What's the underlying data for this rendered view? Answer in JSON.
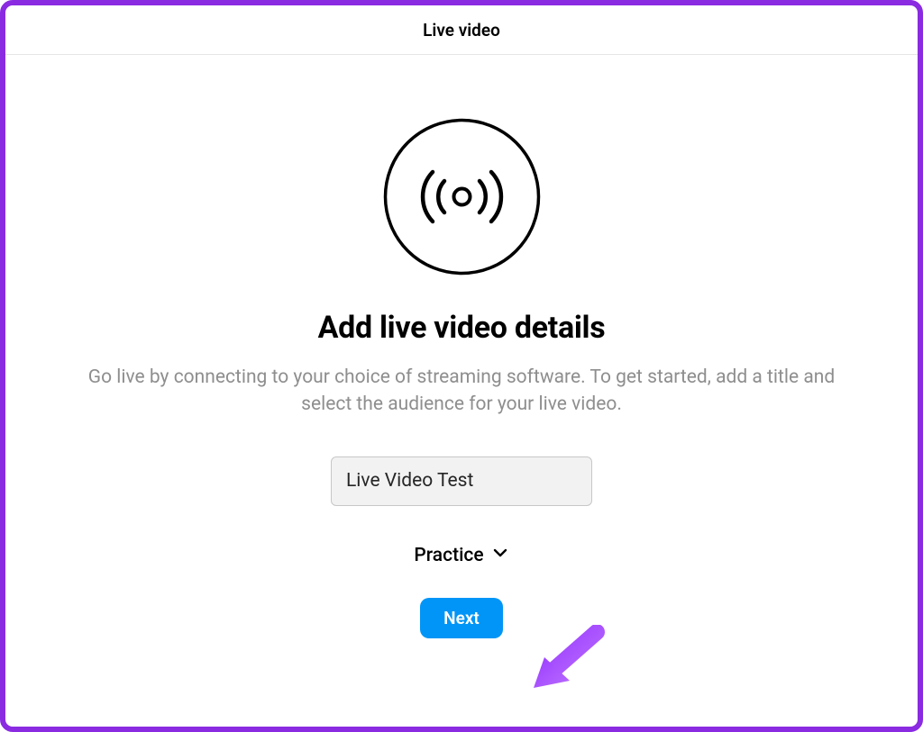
{
  "header": {
    "title": "Live video"
  },
  "main": {
    "heading": "Add live video details",
    "description": "Go live by connecting to your choice of streaming software. To get started, add a title and select the audience for your live video.",
    "title_input_value": "Live Video Test",
    "audience_selected": "Practice",
    "next_button_label": "Next"
  },
  "colors": {
    "frame_border": "#8a2be2",
    "primary_button": "#0095f6",
    "arrow": "#a040ff"
  }
}
